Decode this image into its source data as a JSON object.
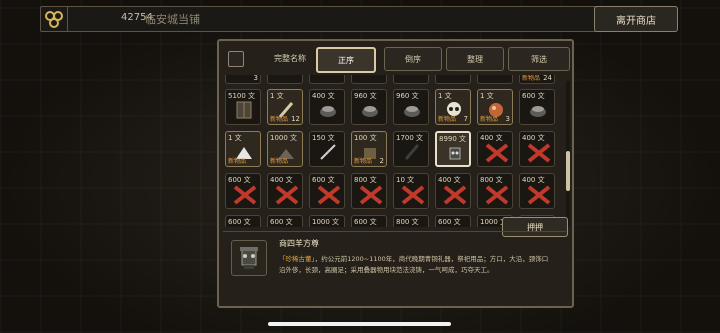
{
  "top_bar": {
    "money": "42754",
    "shop_name": "临安城当铺",
    "leave_button": "离开商店",
    "coin_icon": "coin-stack-icon"
  },
  "filter": {
    "checkbox_label": "完整名称",
    "buttons": [
      "正序",
      "倒序",
      "整理",
      "筛选"
    ],
    "active": "正序"
  },
  "partial_top_row": [
    {
      "price": "",
      "count": "3",
      "new": false
    },
    {
      "price": "",
      "count": "",
      "new": false
    },
    {
      "price": "",
      "count": "",
      "new": false
    },
    {
      "price": "",
      "count": "",
      "new": false
    },
    {
      "price": "",
      "count": "",
      "new": false
    },
    {
      "price": "",
      "count": "",
      "new": false
    },
    {
      "price": "",
      "count": "",
      "new": false
    },
    {
      "price": "",
      "count": "24",
      "new": true
    }
  ],
  "rows": [
    [
      {
        "price": "5100 文",
        "new": false,
        "count": "",
        "sold": false,
        "item": "cabinet-icon",
        "owned": false
      },
      {
        "price": "1 文",
        "new": true,
        "count": "12",
        "sold": false,
        "item": "bone-stick-icon",
        "owned": true
      },
      {
        "price": "400 文",
        "new": false,
        "count": "",
        "sold": false,
        "item": "bowl-icon",
        "owned": false
      },
      {
        "price": "960 文",
        "new": false,
        "count": "",
        "sold": false,
        "item": "bowl-icon",
        "owned": false
      },
      {
        "price": "960 文",
        "new": false,
        "count": "",
        "sold": false,
        "item": "bowl-icon",
        "owned": false
      },
      {
        "price": "1 文",
        "new": true,
        "count": "7",
        "sold": false,
        "item": "skull-icon",
        "owned": true
      },
      {
        "price": "1 文",
        "new": true,
        "count": "3",
        "sold": false,
        "item": "orb-icon",
        "owned": true
      },
      {
        "price": "600 文",
        "new": false,
        "count": "",
        "sold": false,
        "item": "bowl-icon",
        "owned": false
      }
    ],
    [
      {
        "price": "1 文",
        "new": true,
        "count": "",
        "sold": false,
        "item": "salt-pile-icon",
        "owned": true
      },
      {
        "price": "1000 文",
        "new": true,
        "count": "",
        "sold": false,
        "item": "ore-pile-icon",
        "owned": true
      },
      {
        "price": "150 文",
        "new": false,
        "count": "",
        "sold": false,
        "item": "sword-icon",
        "owned": false
      },
      {
        "price": "100 文",
        "new": true,
        "count": "2",
        "sold": false,
        "item": "pot-icon",
        "owned": true
      },
      {
        "price": "1700 文",
        "new": false,
        "count": "",
        "sold": false,
        "item": "staff-icon",
        "owned": false
      },
      {
        "price": "8990 文",
        "new": false,
        "count": "",
        "sold": false,
        "item": "bronze-vessel-icon",
        "owned": false,
        "selected": true
      },
      {
        "price": "400 文",
        "new": false,
        "count": "",
        "sold": true,
        "item": "",
        "owned": false
      },
      {
        "price": "400 文",
        "new": false,
        "count": "",
        "sold": true,
        "item": "",
        "owned": false
      }
    ],
    [
      {
        "price": "600 文",
        "new": false,
        "count": "",
        "sold": true,
        "item": "",
        "owned": false
      },
      {
        "price": "400 文",
        "new": false,
        "count": "",
        "sold": true,
        "item": "",
        "owned": false
      },
      {
        "price": "600 文",
        "new": false,
        "count": "",
        "sold": true,
        "item": "",
        "owned": false
      },
      {
        "price": "800 文",
        "new": false,
        "count": "",
        "sold": true,
        "item": "",
        "owned": false
      },
      {
        "price": "10 文",
        "new": false,
        "count": "",
        "sold": true,
        "item": "",
        "owned": false
      },
      {
        "price": "400 文",
        "new": false,
        "count": "",
        "sold": true,
        "item": "",
        "owned": false
      },
      {
        "price": "800 文",
        "new": false,
        "count": "",
        "sold": true,
        "item": "",
        "owned": false
      },
      {
        "price": "400 文",
        "new": false,
        "count": "",
        "sold": true,
        "item": "",
        "owned": false
      }
    ],
    [
      {
        "price": "600 文",
        "new": false,
        "count": "",
        "sold": true,
        "item": "",
        "owned": false
      },
      {
        "price": "600 文",
        "new": false,
        "count": "",
        "sold": true,
        "item": "",
        "owned": false
      },
      {
        "price": "1000 文",
        "new": false,
        "count": "",
        "sold": true,
        "item": "",
        "owned": false
      },
      {
        "price": "600 文",
        "new": false,
        "count": "",
        "sold": true,
        "item": "",
        "owned": false
      },
      {
        "price": "800 文",
        "new": false,
        "count": "",
        "sold": true,
        "item": "",
        "owned": false
      },
      {
        "price": "600 文",
        "new": false,
        "count": "",
        "sold": true,
        "item": "",
        "owned": false
      },
      {
        "price": "1000 文",
        "new": false,
        "count": "",
        "sold": true,
        "item": "",
        "owned": false
      },
      {
        "price": "",
        "new": false,
        "count": "",
        "sold": true,
        "item": "",
        "owned": false
      }
    ]
  ],
  "new_label": "新物品",
  "pawn_button": "押押",
  "detail": {
    "name": "商四羊方尊",
    "tag": "「珍稀古董」",
    "desc": "，约公元前1200~1100年，商代晚期青铜礼器，祭祀用品；方口，大沿，颈饰口沿外侈，长颈，高圈足；采用叠器物用块范法浇铸，一气呵成，巧夺天工。",
    "icon": "bronze-vessel-icon"
  }
}
